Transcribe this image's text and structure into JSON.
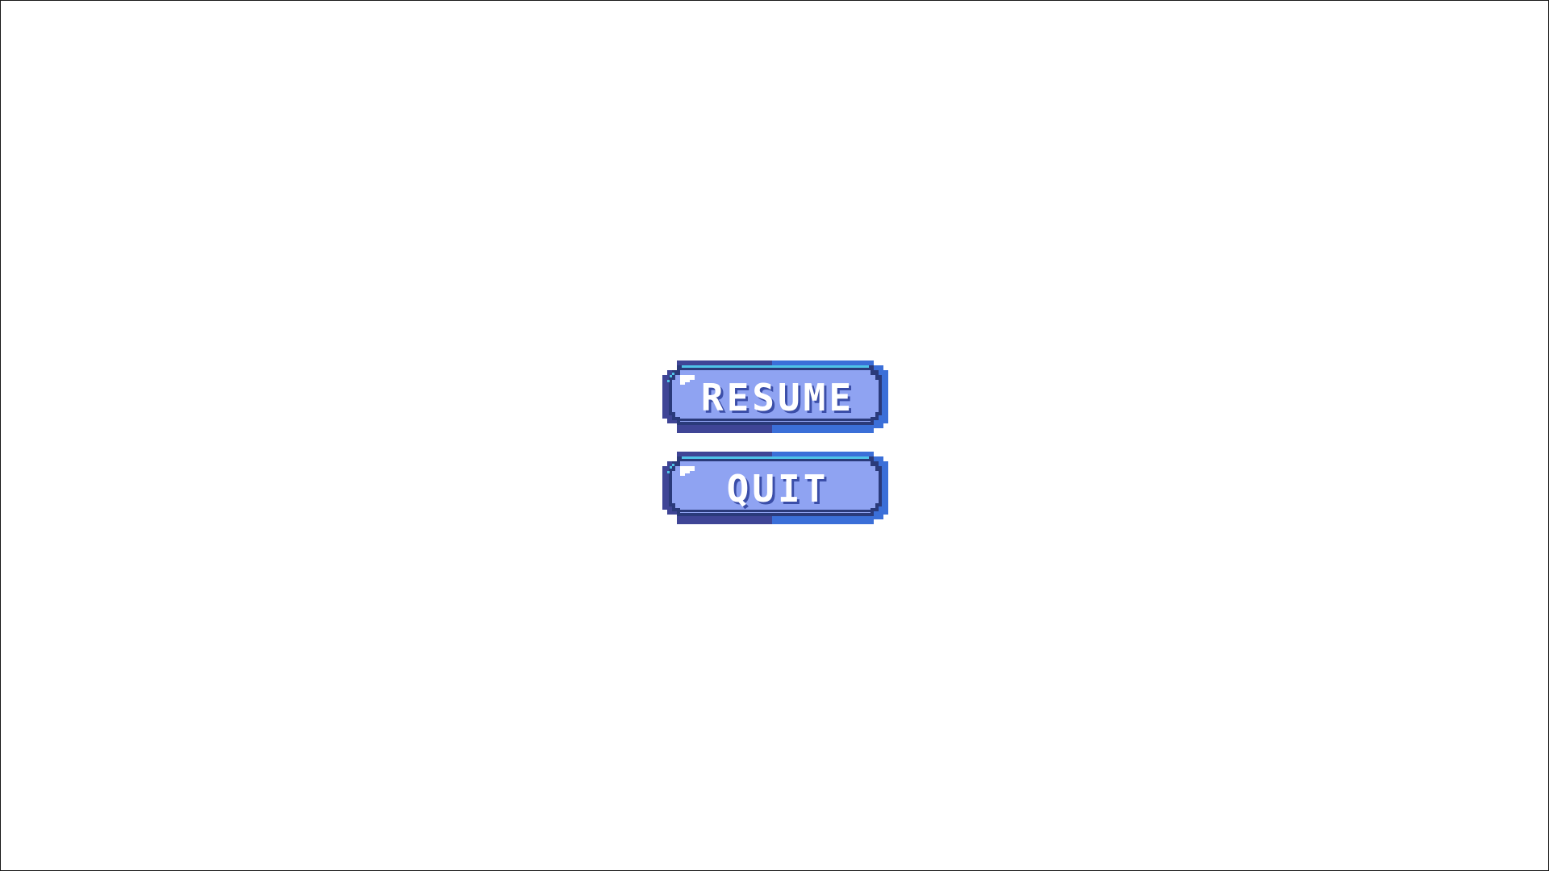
{
  "screen": {
    "title": ""
  },
  "menu": {
    "buttons": [
      {
        "id": "resume",
        "label": "RESUME"
      },
      {
        "id": "quit",
        "label": "QUIT"
      }
    ]
  },
  "colors": {
    "background": "#ffffff",
    "button_fill": "#8fa3f2",
    "button_outline_dark": "#2a3a7a",
    "button_shadow_left": "#3f4596",
    "button_shadow_right": "#3b6fd8",
    "button_highlight": "#4fc3e8",
    "label_text": "#ffffff"
  },
  "icons": {
    "corner_highlight": "sparkle-icon"
  }
}
